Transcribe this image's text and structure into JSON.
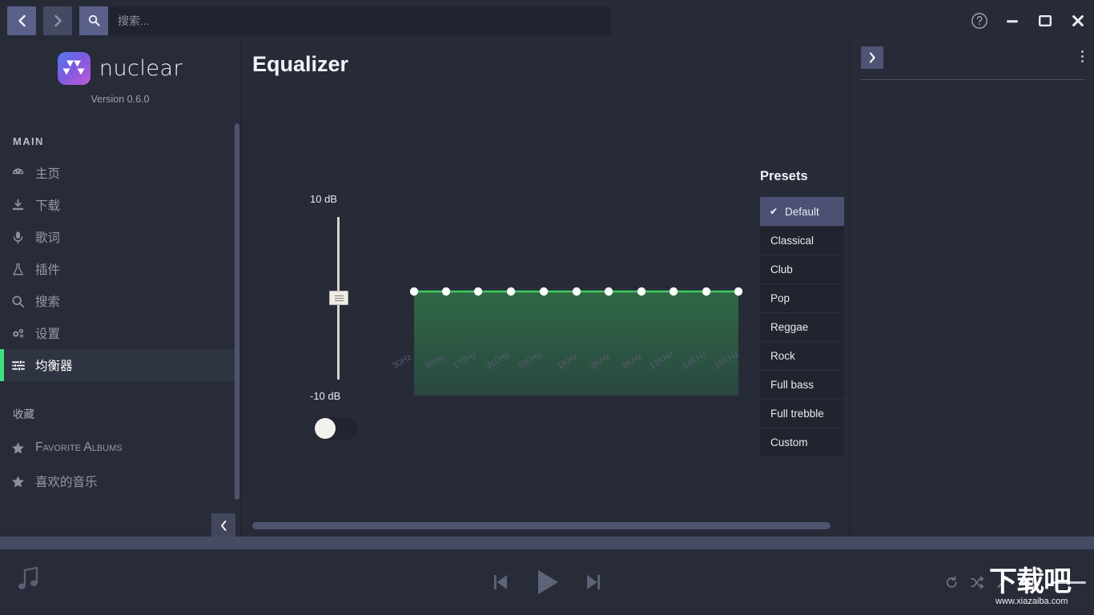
{
  "topbar": {
    "back_label": "back",
    "forward_label": "forward",
    "search_icon": "search-icon",
    "search_value": "",
    "search_placeholder": "搜索...",
    "help_label": "?",
    "minimize_label": "—",
    "maximize_label": "□",
    "close_label": "✕"
  },
  "sidebar": {
    "logo_text": "nuclear",
    "version": "Version 0.6.0",
    "main_section_label": "MAIN",
    "items": [
      {
        "icon": "home-dashboard-icon",
        "label": "主页"
      },
      {
        "icon": "download-icon",
        "label": "下载"
      },
      {
        "icon": "microphone-icon",
        "label": "歌词"
      },
      {
        "icon": "flask-plugin-icon",
        "label": "插件"
      },
      {
        "icon": "search-icon",
        "label": "搜索"
      },
      {
        "icon": "gears-settings-icon",
        "label": "设置"
      },
      {
        "icon": "equalizer-sliders-icon",
        "label": "均衡器",
        "active": true
      }
    ],
    "favorites_section_label": "收藏",
    "favorites": [
      {
        "icon": "star-icon",
        "label": "Favorite Albums"
      },
      {
        "icon": "star-icon",
        "label": "喜欢的音乐"
      }
    ],
    "collapse_label": "‹"
  },
  "main": {
    "title": "Equalizer",
    "pregain_max_label": "10 dB",
    "pregain_min_label": "-10 dB",
    "pregain_value": 0,
    "enabled": false,
    "presets_title": "Presets",
    "presets": [
      {
        "label": "Default",
        "selected": true
      },
      {
        "label": "Classical",
        "selected": false
      },
      {
        "label": "Club",
        "selected": false
      },
      {
        "label": "Pop",
        "selected": false
      },
      {
        "label": "Reggae",
        "selected": false
      },
      {
        "label": "Rock",
        "selected": false
      },
      {
        "label": "Full bass",
        "selected": false
      },
      {
        "label": "Full trebble",
        "selected": false
      },
      {
        "label": "Custom",
        "selected": false
      }
    ],
    "check_glyph": "✔"
  },
  "right_panel": {
    "expand_label": "›",
    "menu_label": "more-options"
  },
  "player": {
    "now_playing_icon": "music-note-icon",
    "previous_label": "previous-track",
    "play_label": "play",
    "next_label": "next-track",
    "repeat_label": "repeat",
    "shuffle_label": "shuffle",
    "autoradio_label": "autoradio-wand",
    "volume_label": "volume",
    "volume_value": 100
  },
  "watermark": {
    "text": "下载吧",
    "url": "www.xiazaiba.com"
  },
  "colors": {
    "accent_green": "#41e07e",
    "eq_line": "#3fcc5e",
    "selected_preset": "#4c5173",
    "button_blue": "#5b608a",
    "bg_dark": "#272b38",
    "bg_panel": "#21242f"
  },
  "chart_data": {
    "type": "line",
    "title": "Equalizer",
    "categories": [
      "30Hz",
      "60Hz",
      "170Hz",
      "310Hz",
      "600Hz",
      "1KHz",
      "3KHz",
      "6KHz",
      "12KHz",
      "14KHz",
      "16KHz"
    ],
    "values": [
      0,
      0,
      0,
      0,
      0,
      0,
      0,
      0,
      0,
      0,
      0
    ],
    "xlabel": "",
    "ylabel": "dB",
    "ylim": [
      -10,
      10
    ],
    "grid": false,
    "legend": "none",
    "annotations": [
      "10 dB",
      "-10 dB"
    ]
  }
}
